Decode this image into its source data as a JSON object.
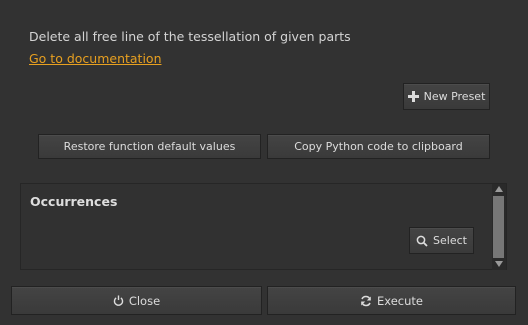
{
  "description": "Delete all free line of the tessellation of given parts",
  "doc_link": "Go to documentation",
  "buttons": {
    "new_preset": "New Preset",
    "restore_defaults": "Restore function default values",
    "copy_python": "Copy Python code to clipboard",
    "select": "Select",
    "close": "Close",
    "execute": "Execute"
  },
  "occurrences": {
    "title": "Occurrences"
  },
  "icons": {
    "new_preset": "plus-icon",
    "select": "magnifier-icon",
    "close": "power-icon",
    "execute": "refresh-icon"
  },
  "colors": {
    "background": "#323232",
    "link": "#e8a020",
    "text": "#dcdcdc"
  }
}
